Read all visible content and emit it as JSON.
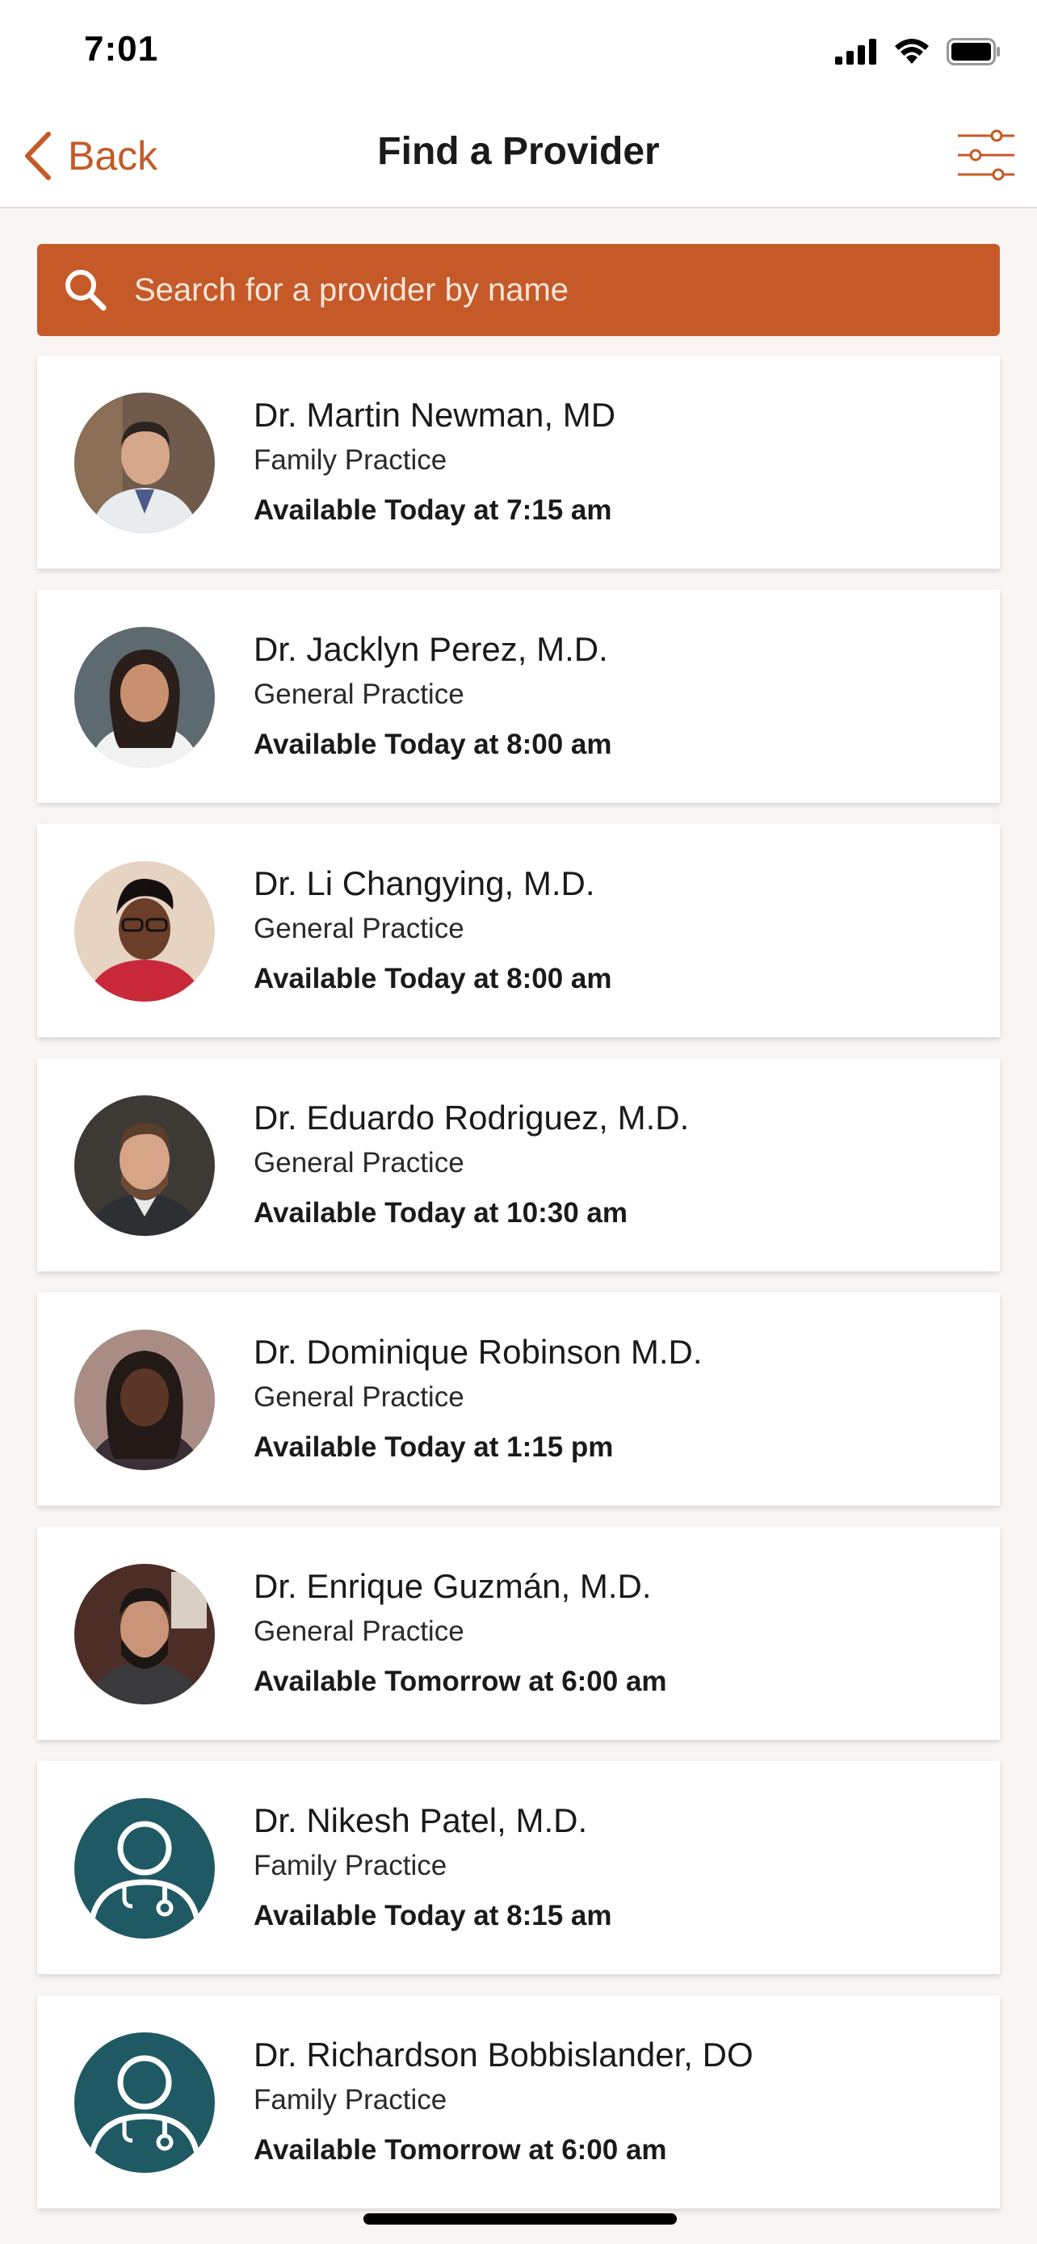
{
  "status_bar": {
    "time": "7:01"
  },
  "nav": {
    "back_label": "Back",
    "title": "Find a Provider"
  },
  "search": {
    "placeholder": "Search for a provider by name"
  },
  "colors": {
    "accent": "#c55a28",
    "avatar_placeholder": "#1f5a64"
  },
  "providers": [
    {
      "name": "Dr. Martin Newman, MD",
      "specialty": "Family Practice",
      "availability": "Available Today at 7:15 am",
      "avatar": "photo"
    },
    {
      "name": "Dr. Jacklyn Perez, M.D.",
      "specialty": "General Practice",
      "availability": "Available Today at 8:00 am",
      "avatar": "photo"
    },
    {
      "name": "Dr. Li Changying, M.D.",
      "specialty": "General Practice",
      "availability": "Available Today at 8:00 am",
      "avatar": "photo"
    },
    {
      "name": "Dr. Eduardo Rodriguez, M.D.",
      "specialty": "General Practice",
      "availability": "Available Today at 10:30 am",
      "avatar": "photo"
    },
    {
      "name": "Dr. Dominique Robinson M.D.",
      "specialty": "General Practice",
      "availability": "Available Today at 1:15 pm",
      "avatar": "photo"
    },
    {
      "name": "Dr. Enrique Guzmán, M.D.",
      "specialty": "General Practice",
      "availability": "Available Tomorrow at 6:00 am",
      "avatar": "photo"
    },
    {
      "name": "Dr. Nikesh Patel, M.D.",
      "specialty": "Family Practice",
      "availability": "Available Today at 8:15 am",
      "avatar": "doctor-placeholder-icon"
    },
    {
      "name": "Dr. Richardson Bobbislander, DO",
      "specialty": "Family Practice",
      "availability": "Available Tomorrow at 6:00 am",
      "avatar": "doctor-placeholder-icon"
    }
  ]
}
